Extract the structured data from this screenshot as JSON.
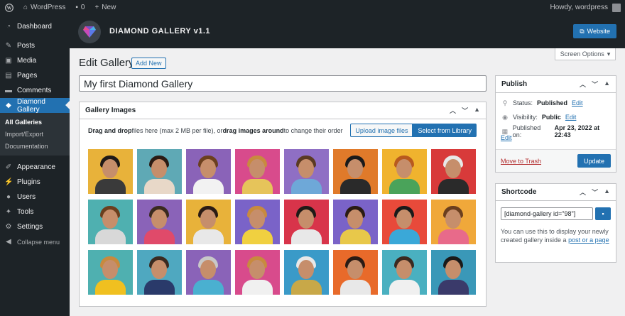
{
  "admin_bar": {
    "site_name": "WordPress",
    "comments_count": "0",
    "new_label": "New",
    "howdy": "Howdy, wordpress"
  },
  "plugin_header": {
    "title": "DIAMOND GALLERY v1.1",
    "website_label": "Website"
  },
  "sidebar": {
    "items": [
      {
        "label": "Dashboard",
        "icon": "dashboard-icon"
      },
      {
        "label": "Posts",
        "icon": "pin-icon"
      },
      {
        "label": "Media",
        "icon": "media-icon"
      },
      {
        "label": "Pages",
        "icon": "page-icon"
      },
      {
        "label": "Comments",
        "icon": "comment-icon"
      },
      {
        "label": "Diamond Gallery",
        "icon": "diamond-icon"
      }
    ],
    "submenu": [
      "All Galleries",
      "Import/Export",
      "Documentation"
    ],
    "items_after": [
      {
        "label": "Appearance",
        "icon": "brush-icon"
      },
      {
        "label": "Plugins",
        "icon": "plugin-icon"
      },
      {
        "label": "Users",
        "icon": "user-icon"
      },
      {
        "label": "Tools",
        "icon": "wrench-icon"
      },
      {
        "label": "Settings",
        "icon": "settings-icon"
      }
    ],
    "collapse_label": "Collapse menu"
  },
  "main": {
    "page_title": "Edit Gallery",
    "add_new_label": "Add New",
    "gallery_title_value": "My first Diamond Gallery",
    "gallery_box": {
      "title": "Gallery Images",
      "drag_text_1": "Drag and drop",
      "drag_text_2": " files here (max 2 MB per file), or ",
      "drag_text_3": "drag images around",
      "drag_text_4": " to change their order",
      "upload_label": "Upload image files",
      "library_label": "Select from Library"
    },
    "images": [
      {
        "bg": "#e8b23a",
        "body": "#3a3a3a",
        "hair": "#1f1a17"
      },
      {
        "bg": "#5fa9b5",
        "body": "#e8d8c8",
        "hair": "#2a1b14"
      },
      {
        "bg": "#8a63b8",
        "body": "#f2f2f2",
        "hair": "#6b3f1e"
      },
      {
        "bg": "#d84b8c",
        "body": "#e6c45a",
        "hair": "#c88a3e"
      },
      {
        "bg": "#8f6fc4",
        "body": "#6ea8d8",
        "hair": "#5a3a22"
      },
      {
        "bg": "#e07a2a",
        "body": "#2a2a2a",
        "hair": "#1a1a1a"
      },
      {
        "bg": "#f0b32e",
        "body": "#4aa35a",
        "hair": "#b85a1e"
      },
      {
        "bg": "#d83a3a",
        "body": "#2a2a2a",
        "hair": "#e8e8e8"
      },
      {
        "bg": "#4fb0b0",
        "body": "#d8d8d8",
        "hair": "#6b3f1e"
      },
      {
        "bg": "#8a63b8",
        "body": "#e04a6a",
        "hair": "#3a2a20"
      },
      {
        "bg": "#e8b23a",
        "body": "#e8e8e8",
        "hair": "#2a1b14"
      },
      {
        "bg": "#7a63c8",
        "body": "#f0d040",
        "hair": "#c88a3e"
      },
      {
        "bg": "#d8344a",
        "body": "#e8e8e8",
        "hair": "#1f1a17"
      },
      {
        "bg": "#7a63c8",
        "body": "#e8c84a",
        "hair": "#2a1b14"
      },
      {
        "bg": "#e84a3a",
        "body": "#3aa8d8",
        "hair": "#1a1a1a"
      },
      {
        "bg": "#f0a83a",
        "body": "#e86a8a",
        "hair": "#6b3f1e"
      },
      {
        "bg": "#4fb0b0",
        "body": "#f0c020",
        "hair": "#c88a3e"
      },
      {
        "bg": "#4fa8c0",
        "body": "#2a3a6a",
        "hair": "#3a2a20"
      },
      {
        "bg": "#8a63b8",
        "body": "#4ab0d0",
        "hair": "#c8c8c8"
      },
      {
        "bg": "#d84b8c",
        "body": "#f0f0f0",
        "hair": "#c88a3e"
      },
      {
        "bg": "#3a9ac8",
        "body": "#c8a848",
        "hair": "#e8e8e8"
      },
      {
        "bg": "#e86a2a",
        "body": "#e8e8e8",
        "hair": "#2a1b14"
      },
      {
        "bg": "#4ab0c0",
        "body": "#f0f0f0",
        "hair": "#3a2a20"
      },
      {
        "bg": "#3a98b8",
        "body": "#3a3a6a",
        "hair": "#1a1a1a"
      }
    ]
  },
  "right": {
    "screen_options_label": "Screen Options",
    "publish": {
      "title": "Publish",
      "status_label": "Status:",
      "status_value": "Published",
      "visibility_label": "Visibility:",
      "visibility_value": "Public",
      "published_label": "Published on:",
      "published_value": "Apr 23, 2022 at 22:43",
      "edit_label": "Edit",
      "trash_label": "Move to Trash",
      "update_label": "Update"
    },
    "shortcode": {
      "title": "Shortcode",
      "value": "[diamond-gallery id=\"98\"]",
      "note_1": "You can use this to display your newly created gallery inside a ",
      "note_link": "post or a page"
    }
  },
  "colors": {
    "accent": "#2271b1",
    "admin_dark": "#1d2327",
    "trash_red": "#b32d2e"
  }
}
